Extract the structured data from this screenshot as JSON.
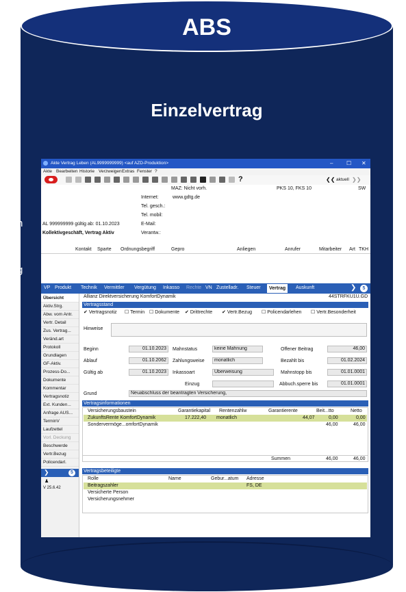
{
  "slide": {
    "title": "ABS",
    "subtitle": "Einzelvertrag",
    "side_text_1": "n",
    "side_text_2": "g"
  },
  "window": {
    "title": "Akte Vertrag Leben (AL9999999999) <auf AZD-Produktion>",
    "menu": [
      "Akte",
      "Bearbeiten",
      "Historie",
      "Verzweigen",
      "Extras",
      "Fenster",
      "?"
    ],
    "nav": {
      "back": "❮❮",
      "current": "aktuell",
      "forward": "❯❯"
    }
  },
  "header": {
    "maz": "MAZ: Nicht vorh.",
    "pks": "PKS 10, FKS 10",
    "sw": "SW",
    "internet_label": "Internet:",
    "internet_value": "www.gdtg.de",
    "tel_gesch_label": "Tel. gesch.:",
    "tel_mobil_label": "Tel. mobil:",
    "account": "AL 999999999   gültig ab: 01.10.2023",
    "email_label": "E-Mail:",
    "contract_desc": "Kollektivgeschäft, Vertrag Aktiv",
    "verantw_label": "Verantw.:"
  },
  "grid": {
    "columns": [
      "Kontakt",
      "Sparte",
      "Ordnungsbegriff",
      "Gepro",
      "Anliegen",
      "Anrufer",
      "Mitarbeiter",
      "Art",
      "TKH"
    ]
  },
  "tabs": [
    "VP",
    "Produkt",
    "Technik",
    "Vermittler",
    "Vergütung",
    "Inkasso",
    "Rechte",
    "VN",
    "Zustelladr.",
    "Steuer",
    "Vertrag",
    "Auskunft"
  ],
  "tab_badge": "5",
  "left_nav": {
    "items": [
      "Übersicht",
      "Aktiv.Strg.",
      "Abw. vom Antr.",
      "Vertr. Detail",
      "Zus. Vertrag...",
      "Veränd.art",
      "Protokoll",
      "Grundlagen",
      "GF-Aktiv.",
      "Prozess-Do...",
      "Dokumente",
      "Kommentar",
      "Vertragsnotiz",
      "Ext. Kunden...",
      "Anfrage AUS...",
      "TerminV",
      "Laufzettel",
      "Vorl. Deckung",
      "Beschwerde",
      "Vertr.Bezug",
      "Policendarl."
    ],
    "badge": "5",
    "version": "V 25.6.42"
  },
  "product": {
    "name": "Allianz Direktversicherung KomfortDynamik",
    "code": "44STRFKU1U.GD"
  },
  "vertragsstand": {
    "title": "Vertragsstand",
    "checks": [
      {
        "label": "Vertragsnotiz",
        "checked": true
      },
      {
        "label": "Termin",
        "checked": false
      },
      {
        "label": "Dokumente",
        "checked": false
      },
      {
        "label": "Drittrechte",
        "checked": true
      },
      {
        "label": "Vertr.Bezug",
        "checked": true
      },
      {
        "label": "Policendarlehen",
        "checked": false
      },
      {
        "label": "Vertr.Besonderheit",
        "checked": false
      }
    ],
    "hinweise_label": "Hinweise",
    "beginn_label": "Beginn",
    "beginn": "01.10.2023",
    "ablauf_label": "Ablauf",
    "ablauf": "01.10.2062",
    "gueltig_label": "Gültig ab",
    "gueltig": "01.10.2023",
    "mahnstatus_label": "Mahnstatus",
    "mahnstatus": "keine Mahnung",
    "zahlungsweise_label": "Zahlungsweise",
    "zahlungsweise": "monatlich",
    "inkassoart_label": "Inkassoart",
    "inkassoart": "Überweisung",
    "einzug_label": "Einzug",
    "einzug": "",
    "offener_label": "Offener Beitrag",
    "offener": "46,00",
    "bezahlt_label": "Bezahlt bis",
    "bezahlt": "01.02.2024",
    "mahnstopp_label": "Mahnstopp bis",
    "mahnstopp": "01.01.0001",
    "abbuch_label": "Abbuch.sperre bis",
    "abbuch": "01.01.0001",
    "grund_label": "Grund",
    "grund": "Neuabschluss der beantragten Versicherung,"
  },
  "vertragsinfo": {
    "title": "Vertragsinformationen",
    "columns": [
      "Versicherungsbaustein",
      "Garantiekapital",
      "Rentenzahlw",
      "Garantierente",
      "Beit...tto",
      "Netto"
    ],
    "rows": [
      [
        "ZukunftsRente KomfortDynamik",
        "17.222,40",
        "monatlich",
        "44,07",
        "0,00",
        "0,00"
      ],
      [
        "Sondervermöge...omfortDynamik",
        "",
        "",
        "",
        "46,00",
        "46,00"
      ]
    ],
    "summen_label": "Summen",
    "summen": [
      "46,00",
      "46,00"
    ]
  },
  "beteiligte": {
    "title": "Vertragsbeteiligte",
    "columns": [
      "Rolle",
      "Name",
      "Gebur...atum",
      "Adresse"
    ],
    "rows": [
      [
        "Beitragszahler",
        "",
        "",
        "FS, DE"
      ],
      [
        "Versicherte Person",
        "",
        "",
        ""
      ],
      [
        "Versicherungsnehmer",
        "",
        "",
        ""
      ]
    ]
  },
  "colors": {
    "navy": "#0f2659",
    "tab_blue": "#2a5fb6",
    "highlight": "#d6e09a",
    "titlebar": "#2457c5"
  }
}
